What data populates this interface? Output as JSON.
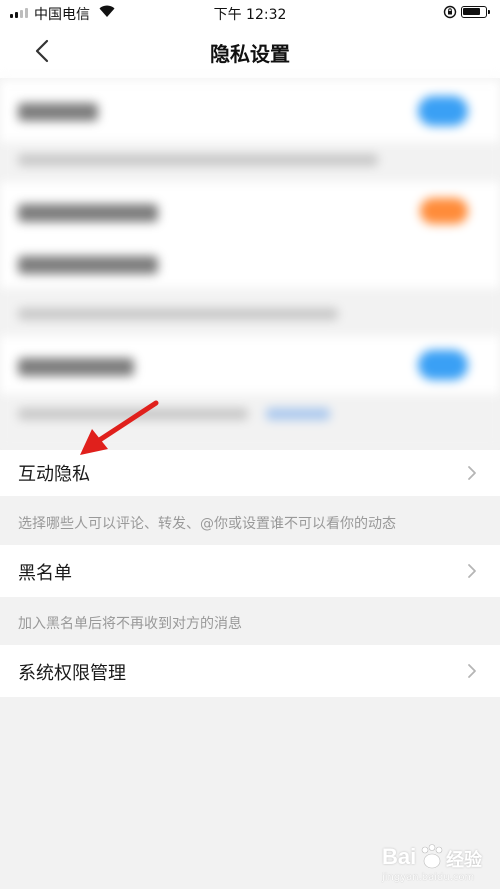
{
  "status_bar": {
    "carrier": "中国电信",
    "time": "下午 12:32"
  },
  "nav": {
    "title": "隐私设置",
    "back_icon": "chevron-left-icon"
  },
  "items": [
    {
      "label": "互动隐私",
      "description": "选择哪些人可以评论、转发、@你或设置谁不可以看你的动态"
    },
    {
      "label": "黑名单",
      "description": "加入黑名单后将不再收到对方的消息"
    },
    {
      "label": "系统权限管理"
    }
  ],
  "colors": {
    "annotation_arrow": "#e0201c",
    "toggle_on": "#3aa0f5",
    "toggle_orange": "#ff8c3a"
  },
  "watermark": {
    "brand": "Bai",
    "brand_cn": "经验",
    "url": "jingyan.baidu.com"
  }
}
